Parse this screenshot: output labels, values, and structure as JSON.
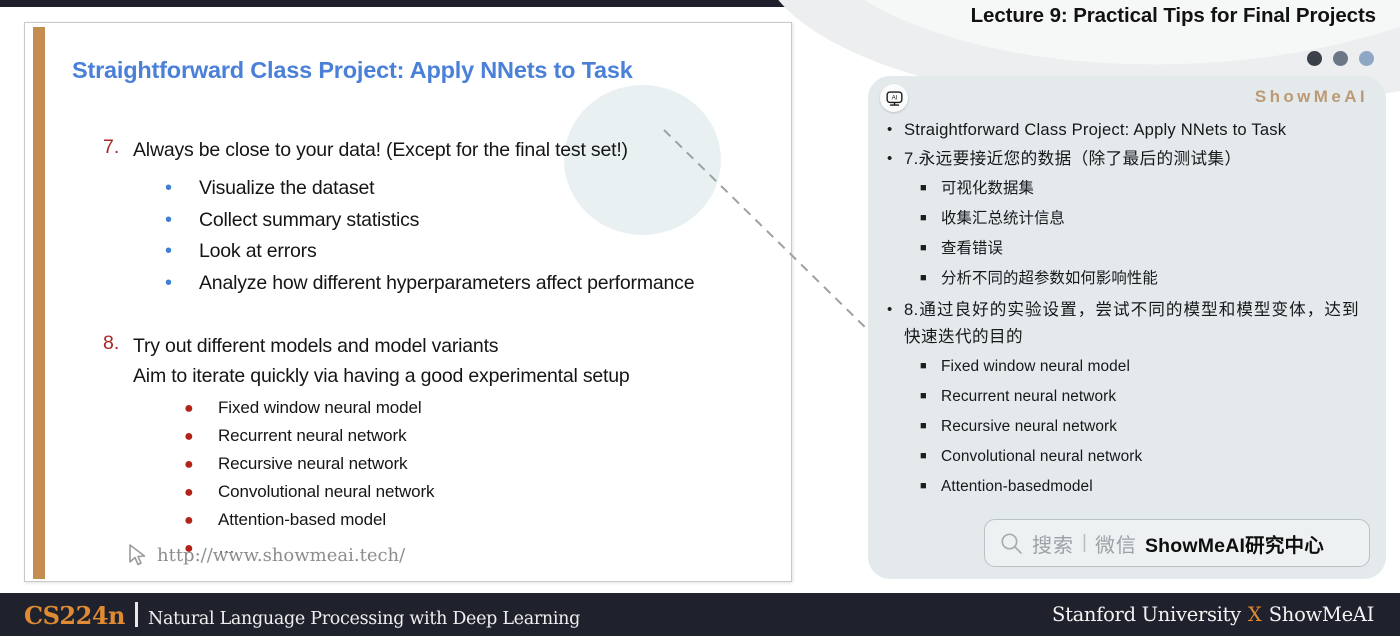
{
  "header": {
    "lecture_title": "Lecture 9: Practical Tips for Final Projects",
    "dots": [
      "#3c4048",
      "#6b7787",
      "#8fa7c4"
    ]
  },
  "slide": {
    "title": "Straightforward Class Project: Apply NNets to Task",
    "accent_color": "#c68d53",
    "title_color": "#4a80d8",
    "items": [
      {
        "number": "7.",
        "text": "Always be close to your data! (Except for the final test set!)",
        "bullet_color": "#3d7fd0",
        "subitems": [
          "Visualize the dataset",
          "Collect summary statistics",
          "Look at errors",
          "Analyze how different hyperparameters affect performance"
        ]
      },
      {
        "number": "8.",
        "text_line1": "Try out different models and model variants",
        "text_line2": "Aim to iterate quickly via having a good experimental setup",
        "bullet_color": "#b02418",
        "subitems": [
          "Fixed window neural model",
          "Recurrent neural network",
          "Recursive neural network",
          "Convolutional neural network",
          "Attention-based model",
          "…"
        ]
      }
    ],
    "url": "http://www.showmeai.tech/",
    "cursor_icon": "pointer-arrow-icon"
  },
  "ai_panel": {
    "avatar_icon": "ai-robot-icon",
    "avatar_label": "AI",
    "brand": "ShowMeAI",
    "brand_color": "#bb9a75",
    "blocks": [
      {
        "bullet": "•",
        "text": "Straightforward  Class  Project:  Apply  NNets  to  Task",
        "justify": true,
        "subitems": []
      },
      {
        "bullet": "•",
        "text": "7.永远要接近您的数据（除了最后的测试集）",
        "justify": false,
        "subitems": [
          "可视化数据集",
          "收集汇总统计信息",
          "查看错误",
          "分析不同的超参数如何影响性能"
        ]
      },
      {
        "bullet": "•",
        "text": "8.通过良好的实验设置，尝试不同的模型和模型变体，达到快速迭代的目的",
        "justify": true,
        "subitems": [
          "Fixed window neural model",
          "Recurrent neural network",
          "Recursive neural network",
          "Convolutional neural network",
          "Attention-basedmodel"
        ]
      }
    ],
    "search": {
      "icon": "search-icon",
      "placeholder": "搜索",
      "separator": "|",
      "channel": "微信",
      "strong": "ShowMeAI研究中心"
    }
  },
  "bottom_bar": {
    "course_code": "CS224n",
    "course_name": "Natural Language Processing with Deep Learning",
    "org_left": "Stanford University",
    "org_x": "X",
    "org_right": "ShowMeAI",
    "accent_color": "#e08a33",
    "background": "#1f222c"
  }
}
